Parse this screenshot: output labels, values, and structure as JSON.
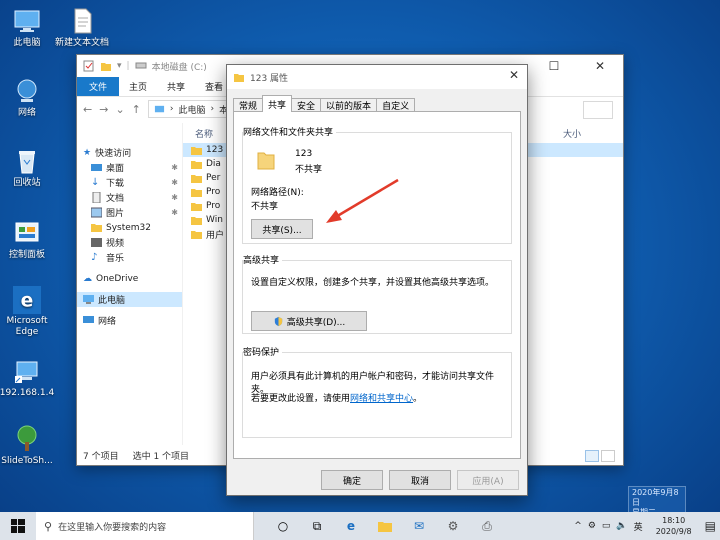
{
  "desktop": {
    "icons": [
      {
        "label": "此电脑"
      },
      {
        "label": "新建文本文档"
      },
      {
        "label": "网络"
      },
      {
        "label": "回收站"
      },
      {
        "label": "控制面板"
      },
      {
        "label": "Microsoft Edge"
      },
      {
        "label": "192.168.1.4"
      },
      {
        "label": "SlideToSh..."
      }
    ]
  },
  "explorer": {
    "title": "本地磁盘 (C:)",
    "ribbon_tabs": [
      "文件",
      "主页",
      "共享",
      "查看"
    ],
    "address": {
      "root": "此电脑",
      "next": "本"
    },
    "nav": {
      "quick_access": "快速访问",
      "items": [
        "桌面",
        "下载",
        "文档",
        "图片",
        "System32",
        "视频",
        "音乐"
      ],
      "onedrive": "OneDrive",
      "this_pc": "此电脑",
      "network": "网络"
    },
    "columns": {
      "name": "名称",
      "size": "大小"
    },
    "files": [
      "123",
      "Dia",
      "Per",
      "Pro",
      "Pro",
      "Win",
      "用户"
    ],
    "status": {
      "count": "7 个项目",
      "selected": "选中 1 个项目"
    }
  },
  "dialog": {
    "title": "123 属性",
    "tabs": [
      "常规",
      "共享",
      "安全",
      "以前的版本",
      "自定义"
    ],
    "sharing": {
      "group_title": "网络文件和文件夹共享",
      "folder_name": "123",
      "folder_state": "不共享",
      "path_label": "网络路径(N):",
      "path_value": "不共享",
      "share_button": "共享(S)..."
    },
    "advanced": {
      "group_title": "高级共享",
      "description": "设置自定义权限，创建多个共享，并设置其他高级共享选项。",
      "button": "高级共享(D)..."
    },
    "password": {
      "group_title": "密码保护",
      "description": "用户必须具有此计算机的用户帐户和密码，才能访问共享文件夹。",
      "change_prefix": "若要更改此设置，请使用",
      "link": "网络和共享中心",
      "suffix": "。"
    },
    "buttons": {
      "ok": "确定",
      "cancel": "取消",
      "apply": "应用(A)"
    }
  },
  "taskbar": {
    "search_placeholder": "在这里输入你要搜索的内容",
    "ime": "英",
    "time": "18:10",
    "date": "2020/9/8",
    "tooltip_date": "2020年9月8日",
    "tooltip_day": "星期二"
  },
  "colors": {
    "accent": "#1979ca",
    "arrow": "#e23b2a",
    "link": "#0066cc"
  }
}
